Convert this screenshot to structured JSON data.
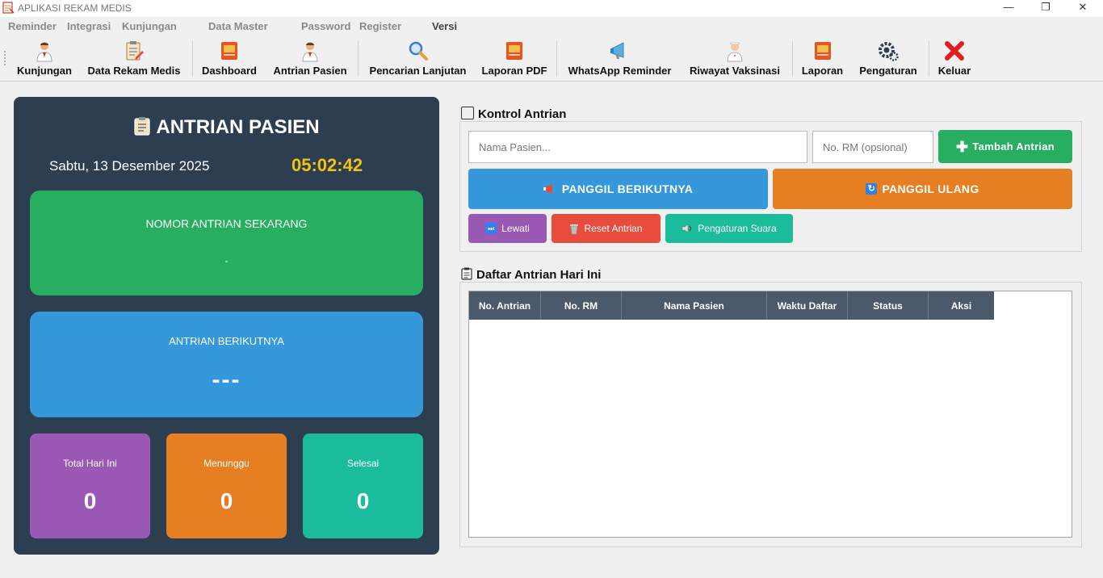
{
  "window": {
    "title": "APLIKASI REKAM MEDIS",
    "minimize": "—",
    "restore": "❐",
    "close": "✕"
  },
  "menu": [
    "Reminder",
    "Integrasi",
    "Kunjungan",
    "Data Master",
    "Password",
    "Register",
    "Versi"
  ],
  "toolbar": [
    {
      "label": "Kunjungan",
      "icon": "doctor-icon"
    },
    {
      "label": "Data Rekam Medis",
      "icon": "clipboard-edit-icon"
    },
    {
      "label": "Dashboard",
      "icon": "report-book-icon"
    },
    {
      "label": "Antrian Pasien",
      "icon": "doctor-icon"
    },
    {
      "label": "Pencarian Lanjutan",
      "icon": "magnifier-icon"
    },
    {
      "label": "Laporan PDF",
      "icon": "report-book-icon"
    },
    {
      "label": "WhatsApp Reminder",
      "icon": "megaphone-icon"
    },
    {
      "label": "Riwayat Vaksinasi",
      "icon": "nurse-icon"
    },
    {
      "label": "Laporan",
      "icon": "report-book-icon"
    },
    {
      "label": "Pengaturan",
      "icon": "gears-icon"
    },
    {
      "label": "Keluar",
      "icon": "red-x-icon"
    }
  ],
  "queue_display": {
    "title": "ANTRIAN PASIEN",
    "date": "Sabtu, 13 Desember 2025",
    "time": "05:02:42",
    "current_label": "NOMOR ANTRIAN SEKARANG",
    "current_value": "-",
    "next_label": "ANTRIAN BERIKUTNYA",
    "next_value": "---",
    "stats": [
      {
        "label": "Total Hari Ini",
        "value": "0",
        "color": "#9b59b6"
      },
      {
        "label": "Menunggu",
        "value": "0",
        "color": "#e67e22"
      },
      {
        "label": "Selesai",
        "value": "0",
        "color": "#1abc9c"
      }
    ]
  },
  "control": {
    "title": "Kontrol Antrian",
    "name_placeholder": "Nama Pasien...",
    "rm_placeholder": "No. RM (opsional)",
    "add_label": "Tambah Antrian",
    "call_next_label": "PANGGIL BERIKUTNYA",
    "recall_label": "PANGGIL ULANG",
    "skip_label": "Lewati",
    "reset_label": "Reset Antrian",
    "sound_label": "Pengaturan Suara"
  },
  "list": {
    "title": "Daftar Antrian Hari Ini",
    "columns": [
      "No. Antrian",
      "No. RM",
      "Nama Pasien",
      "Waktu Daftar",
      "Status",
      "Aksi"
    ],
    "rows": []
  },
  "colors": {
    "panel": "#2c3e50",
    "green": "#27ae60",
    "blue": "#3498db",
    "orange": "#e67e22",
    "purple": "#9b59b6",
    "red": "#e74c3c",
    "teal": "#1abc9c",
    "clock": "#f1c40f"
  }
}
